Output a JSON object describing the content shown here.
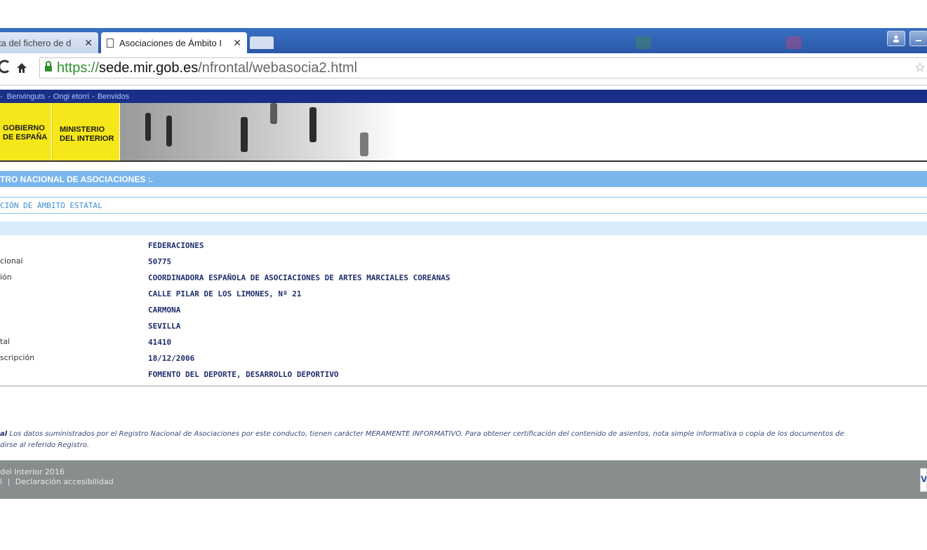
{
  "browser": {
    "tabs": [
      {
        "title": "ta del fichero de d",
        "active": false
      },
      {
        "title": "Asociaciones de Ámbito I",
        "active": true
      }
    ],
    "close_glyph": "✕",
    "url": {
      "scheme": "https://",
      "host": "sede.mir.gob.es",
      "path": "/nfrontal/webasocia2.html"
    }
  },
  "langbar": {
    "items": [
      "Benvinguts",
      "Ongi etorri",
      "Benvidos"
    ],
    "leading": "-",
    "separator": "-"
  },
  "header": {
    "logo_gobierno_line1": "GOBIERNO",
    "logo_gobierno_line2": "DE ESPAÑA",
    "logo_ministerio_line1": "MINISTERIO",
    "logo_ministerio_line2": "DEL INTERIOR"
  },
  "section_title": "TRO NACIONAL DE ASOCIACIONES :.",
  "subsection_title": "CIÓN DE ÁMBITO ESTATAL",
  "details": [
    {
      "label": "",
      "value": "FEDERACIONES"
    },
    {
      "label": "cional",
      "value": "50775"
    },
    {
      "label": "ión",
      "value": "COORDINADORA ESPAÑOLA DE ASOCIACIONES DE ARTES MARCIALES COREANAS"
    },
    {
      "label": "",
      "value": "CALLE PILAR DE LOS LIMONES, Nº 21"
    },
    {
      "label": "",
      "value": "CARMONA"
    },
    {
      "label": "",
      "value": "SEVILLA"
    },
    {
      "label": "tal",
      "value": "41410"
    },
    {
      "label": "scripción",
      "value": "18/12/2006"
    },
    {
      "label": "",
      "value": "FOMENTO DEL DEPORTE, DESARROLLO DEPORTIVO"
    }
  ],
  "disclaimer": {
    "bold": "al",
    "line1": " Los datos suministrados por el Registro Nacional de Asociaciones por este conducto, tienen carácter MERAMENTE INFORMATIVO. Para obtener certificación del contenido de asientos, nota simple informativa o copia de los documentos de",
    "line2": "dirse al referido Registro."
  },
  "footer": {
    "line1": "del Interior 2016",
    "link_prefix": "l",
    "link_separator": "|",
    "link_accessibility": "Declaración accesibilidad",
    "badge": "V"
  },
  "colors": {
    "tabstrip": "#2a58a8",
    "langbar": "#1a2f87",
    "logo_yellow": "#f6e71a",
    "section_bar": "#79b6ea",
    "value_text": "#1f2f6b",
    "footer": "#888d8e",
    "secure_green": "#2f8f2f"
  }
}
